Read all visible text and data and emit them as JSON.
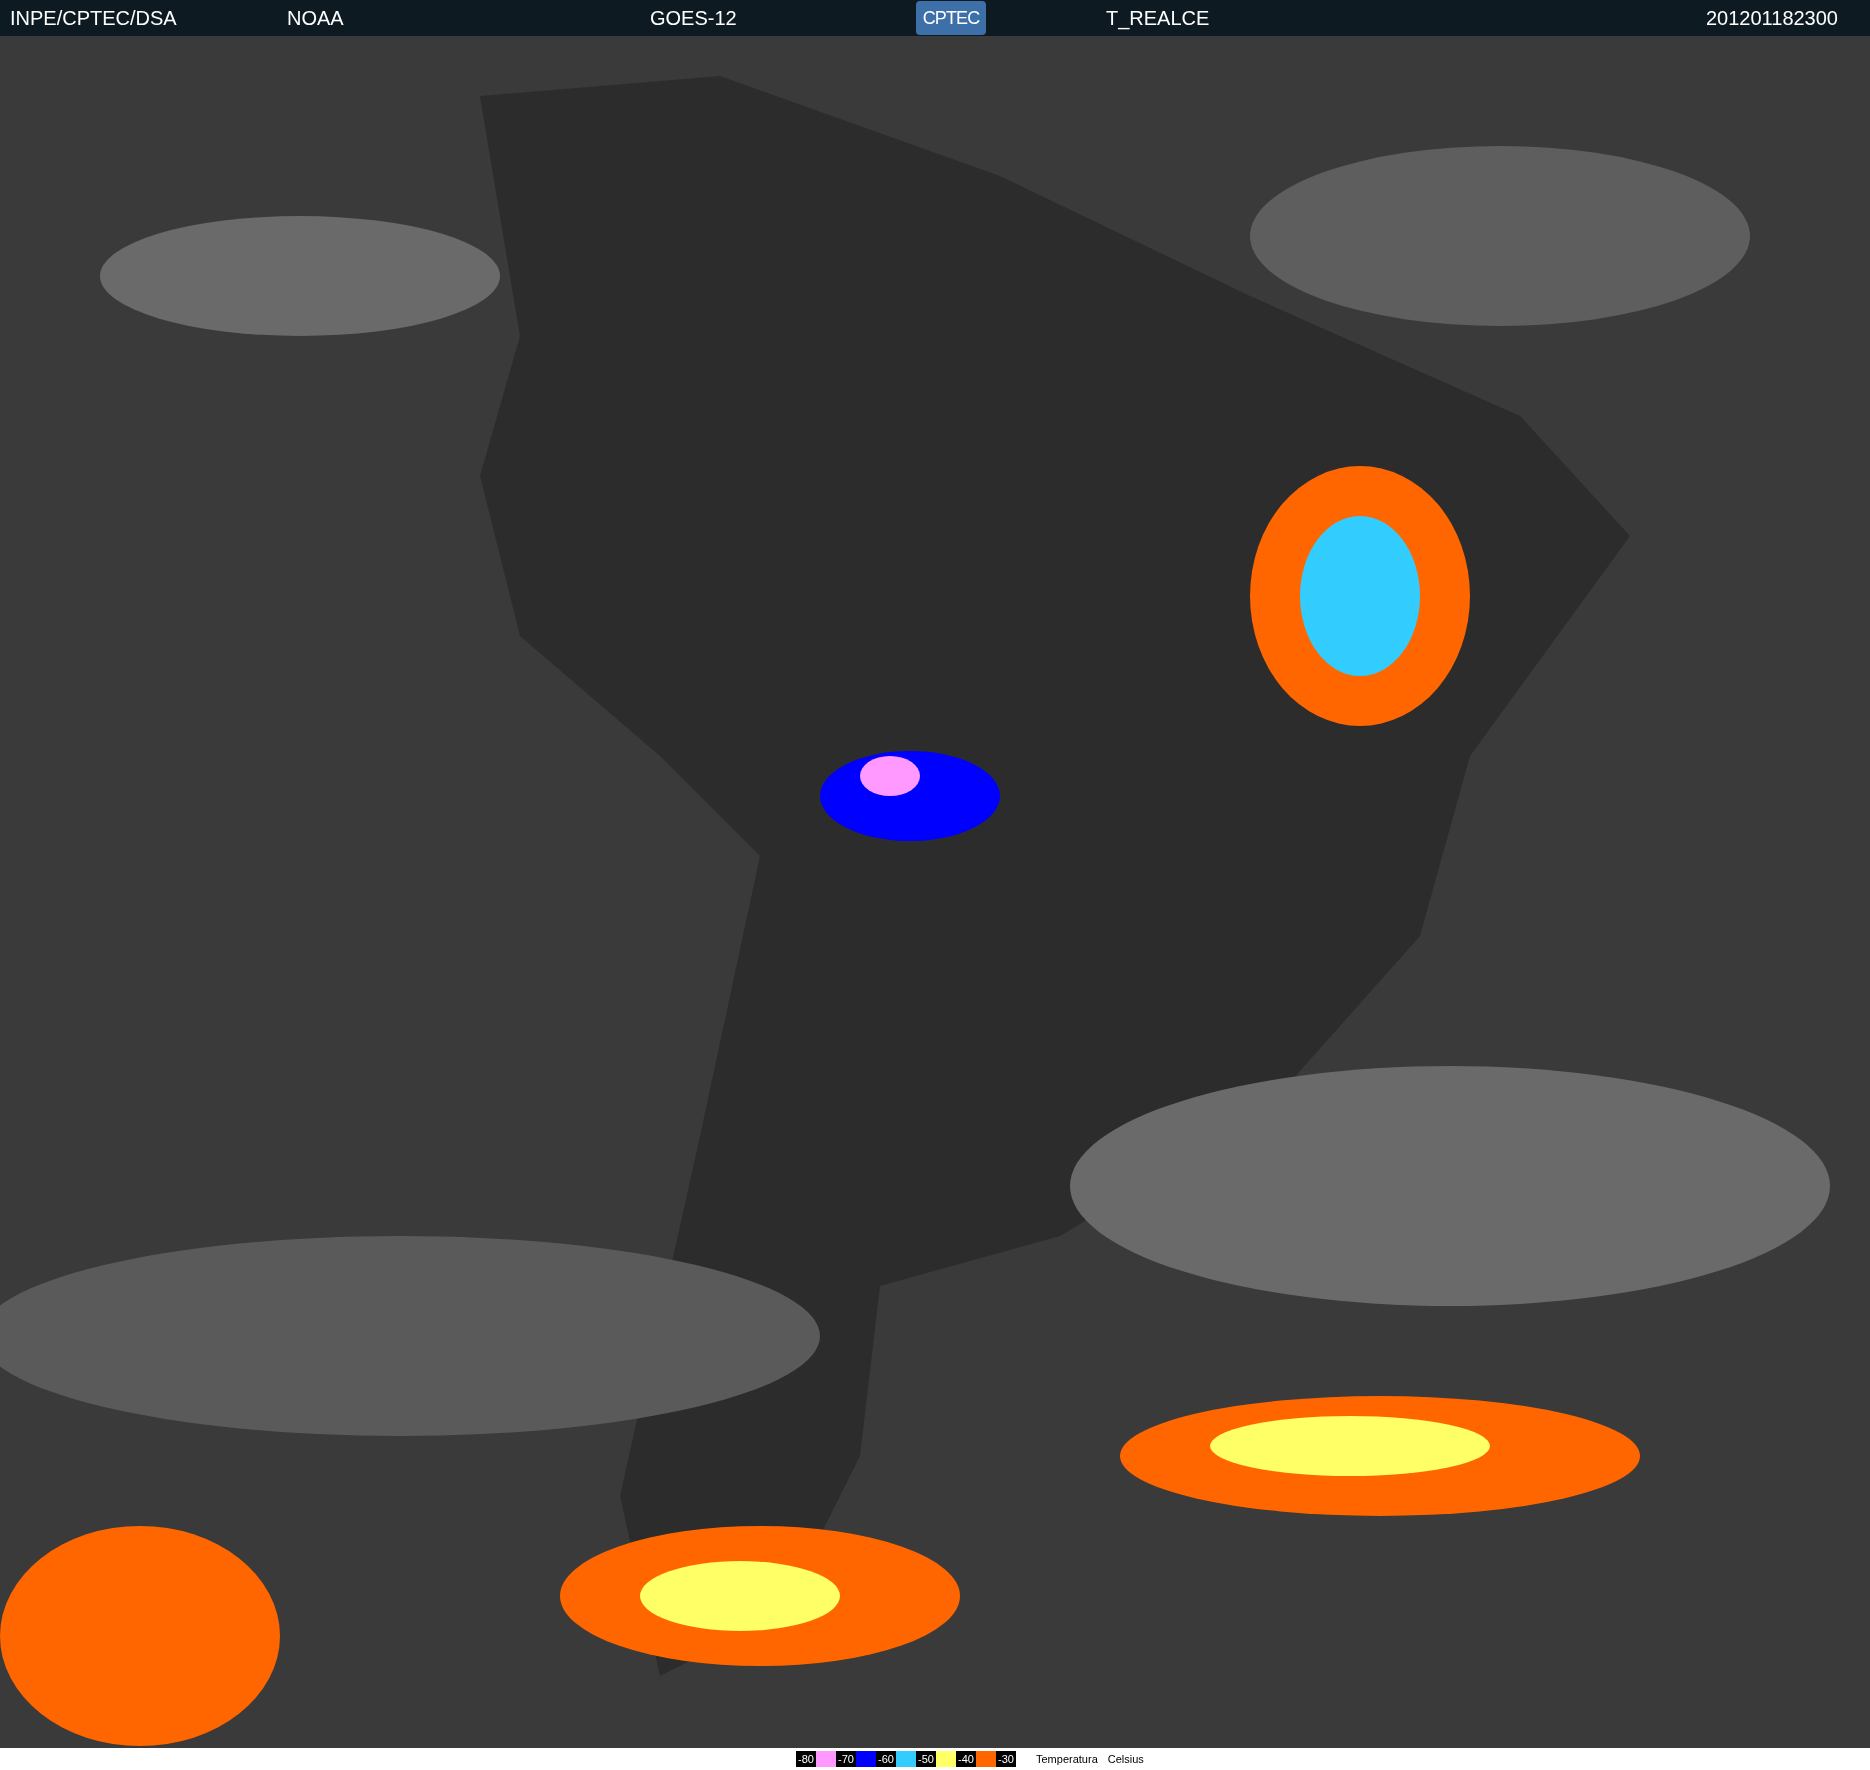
{
  "header": {
    "agency": "INPE/CPTEC/DSA",
    "source": "NOAA",
    "satellite": "GOES-12",
    "logo": "CPTEC",
    "product": "T_REALCE",
    "timestamp": "201201182300"
  },
  "legend": {
    "items": [
      {
        "kind": "label",
        "text": "-80"
      },
      {
        "kind": "swatch",
        "color": "#ff99ff"
      },
      {
        "kind": "label",
        "text": "-70"
      },
      {
        "kind": "swatch",
        "color": "#0000ff"
      },
      {
        "kind": "label",
        "text": "-60"
      },
      {
        "kind": "swatch",
        "color": "#33ccff"
      },
      {
        "kind": "label",
        "text": "-50"
      },
      {
        "kind": "swatch",
        "color": "#ffff66"
      },
      {
        "kind": "label",
        "text": "-40"
      },
      {
        "kind": "swatch",
        "color": "#ff6600"
      },
      {
        "kind": "label",
        "text": "-30"
      }
    ],
    "caption": [
      "Temperatura",
      "Celsius"
    ]
  }
}
